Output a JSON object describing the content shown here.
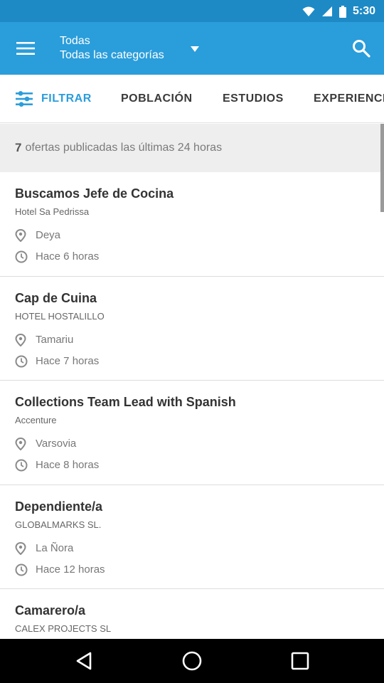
{
  "status_bar": {
    "time": "5:30"
  },
  "app_bar": {
    "title": "Todas",
    "subtitle": "Todas las categorías",
    "colors": {
      "primary": "#2a9ddb",
      "status": "#1d8ac6"
    }
  },
  "tabs": [
    {
      "label": "FILTRAR",
      "icon": "filter-sliders-icon"
    },
    {
      "label": "POBLACIÓN"
    },
    {
      "label": "ESTUDIOS"
    },
    {
      "label": "EXPERIENCIA"
    }
  ],
  "banner": {
    "count": "7",
    "text": "ofertas publicadas las últimas 24 horas"
  },
  "jobs": [
    {
      "title": "Buscamos Jefe de Cocina",
      "company": "Hotel Sa Pedrissa",
      "location": "Deya",
      "time": "Hace 6 horas"
    },
    {
      "title": "Cap de Cuina",
      "company": "HOTEL HOSTALILLO",
      "location": "Tamariu",
      "time": "Hace 7 horas"
    },
    {
      "title": "Collections Team Lead with Spanish",
      "company": "Accenture",
      "location": "Varsovia",
      "time": "Hace 8 horas"
    },
    {
      "title": "Dependiente/a",
      "company": "GLOBALMARKS SL.",
      "location": "La Ñora",
      "time": "Hace 12 horas"
    },
    {
      "title": "Camarero/a",
      "company": "CALEX PROJECTS SL",
      "location": "",
      "time": ""
    }
  ]
}
